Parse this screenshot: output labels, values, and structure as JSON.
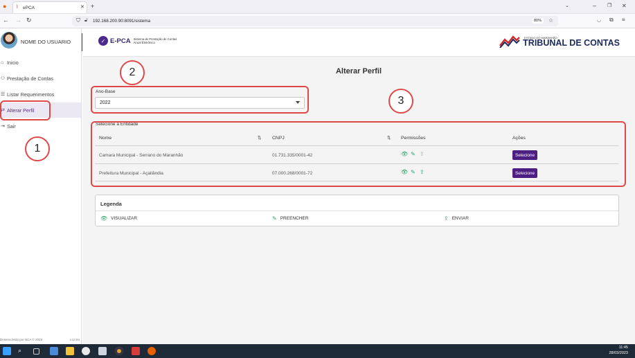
{
  "browser": {
    "tab_title": "ePCA",
    "url": "192.168.200.90:8091/sistema",
    "zoom": "80%"
  },
  "sidebar": {
    "user_name": "NOME DO USUARIO",
    "items": [
      {
        "label": "Inicio",
        "icon": "home-icon"
      },
      {
        "label": "Prestação de Contas",
        "icon": "people-icon"
      },
      {
        "label": "Listar Requerimentos",
        "icon": "list-icon"
      },
      {
        "label": "Alterar Perfil",
        "icon": "switch-icon",
        "active": true
      },
      {
        "label": "Sair",
        "icon": "logout-icon"
      }
    ],
    "footer_left": "Desenvolvido por NCA © 2023",
    "footer_right": "v.12.84"
  },
  "header": {
    "app_short": "E-PCA",
    "app_subtitle": "Sistema de Prestação de Contas Anual Eletrônico",
    "org_small": "ESTADO DO MARANHÃO",
    "org_name": "TRIBUNAL DE CONTAS"
  },
  "main": {
    "title": "Alterar Perfil",
    "ano_base": {
      "label": "Ano-Base",
      "value": "2022"
    },
    "entity_label": "Selecione a Entidade",
    "columns": [
      "Nome",
      "CNPJ",
      "Permissões",
      "Ações"
    ],
    "rows": [
      {
        "nome": "Camara Municipal - Serrano do Maranhão",
        "cnpj": "01.731.335/0001-42",
        "action": "Selecione"
      },
      {
        "nome": "Prefeitura Municipal - Açailândia",
        "cnpj": "07.000.268/0001-72",
        "action": "Selecione"
      }
    ],
    "legend": {
      "title": "Legenda",
      "items": [
        "VISUALIZAR",
        "PREENCHER",
        "ENVIAR"
      ]
    }
  },
  "annotations": [
    "1",
    "2",
    "3"
  ],
  "taskbar": {
    "time": "11:45",
    "date": "28/03/2023"
  },
  "colors": {
    "accent": "#4e1f83",
    "annotation": "#e04848",
    "visualizar": "#2aa26a",
    "preencher": "#2aa26a",
    "enviar": "#2aa26a"
  }
}
